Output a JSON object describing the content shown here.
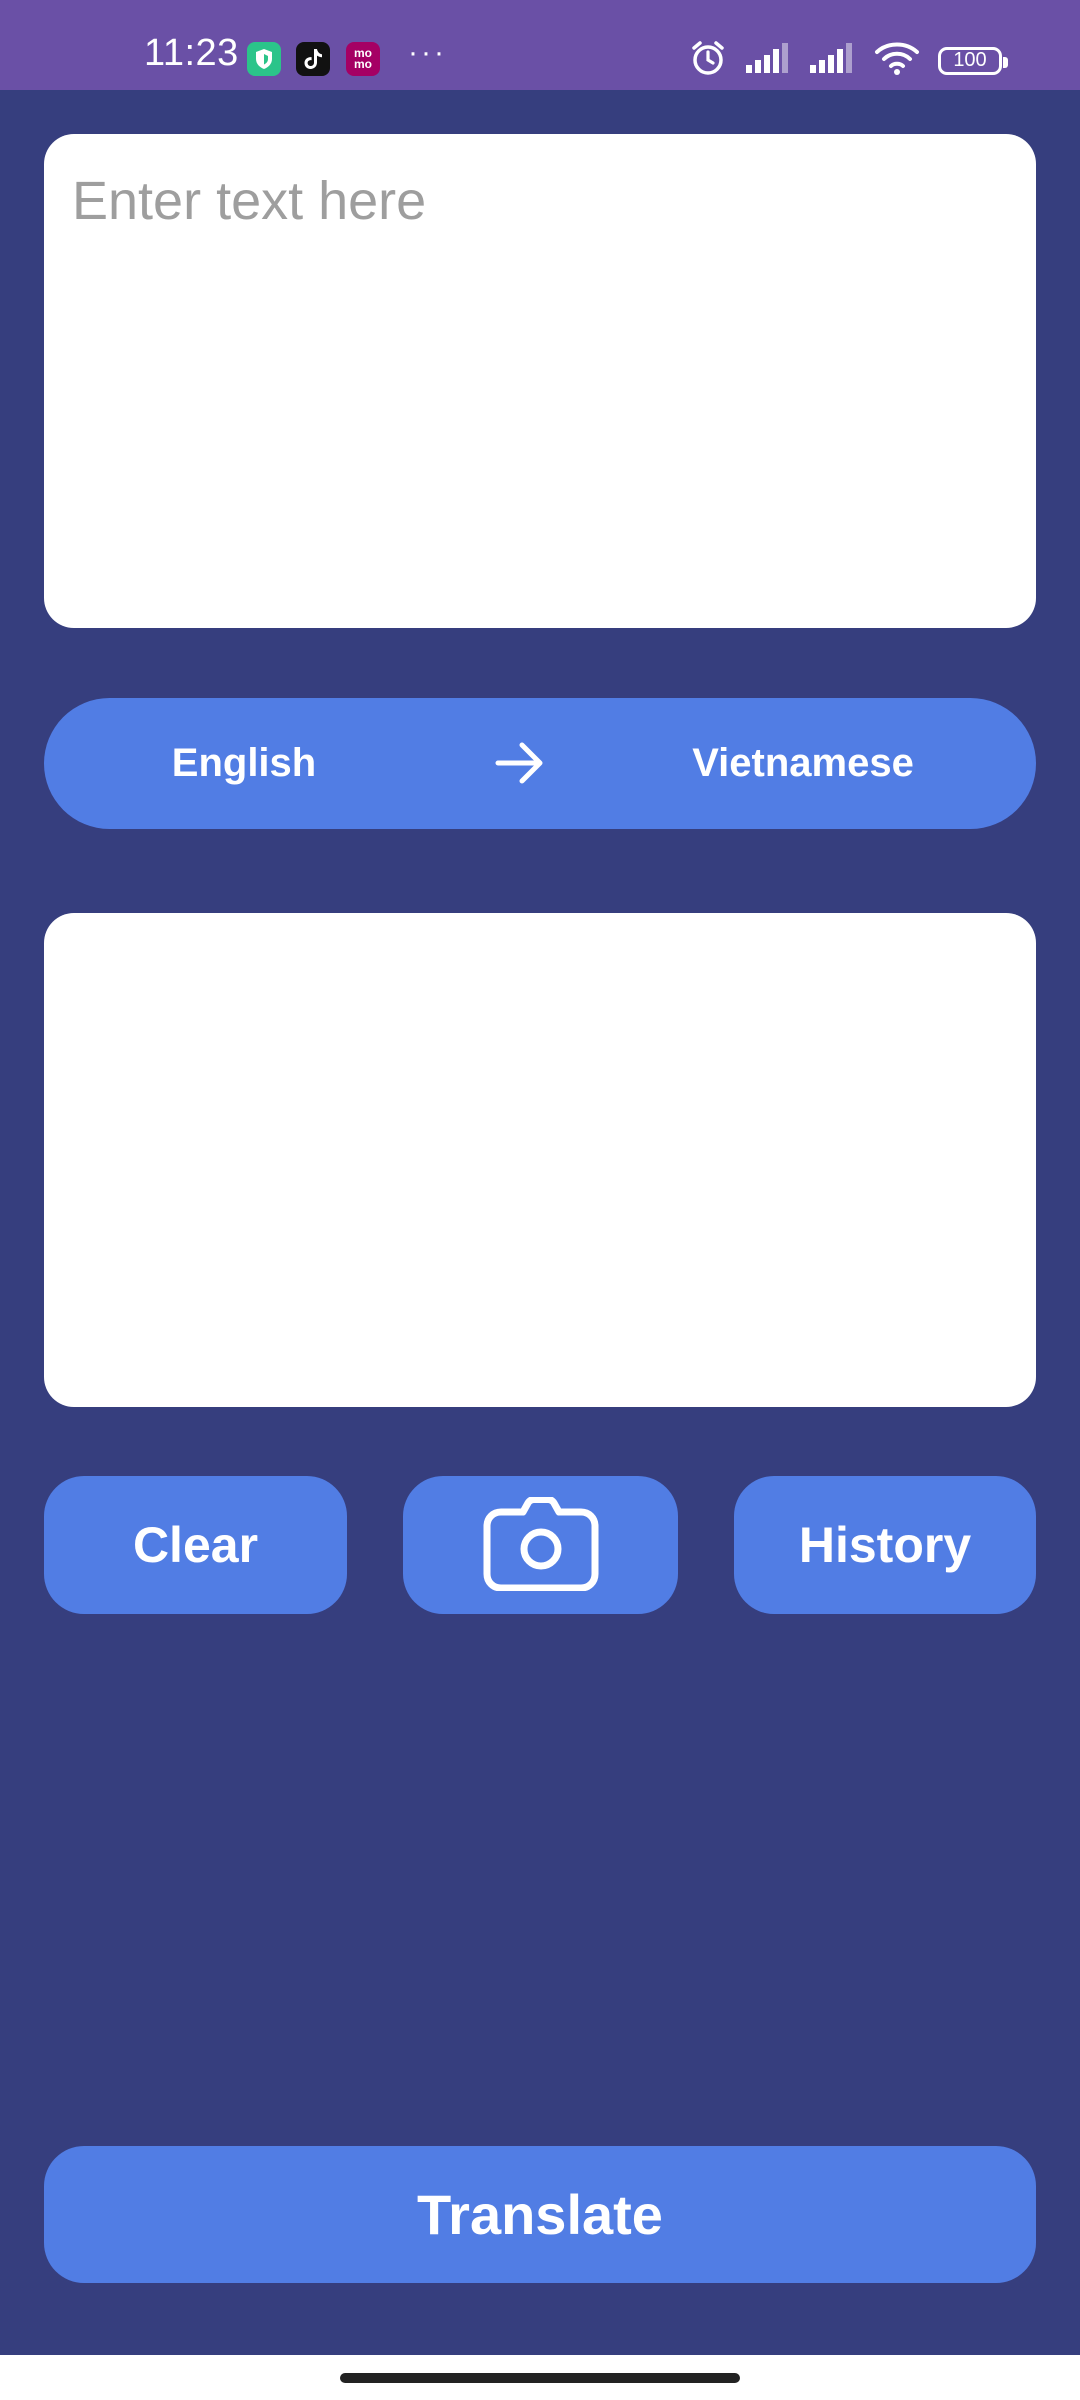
{
  "status_bar": {
    "time": "11:23",
    "app_icons": [
      "shield-icon",
      "tiktok-icon",
      "momo-icon"
    ],
    "momo_label": "mo mo",
    "overflow": "···",
    "battery_level": "100",
    "system_icons": [
      "alarm-icon",
      "signal-icon",
      "signal-icon",
      "wifi-icon",
      "battery-icon"
    ]
  },
  "input": {
    "placeholder": "Enter text here",
    "value": ""
  },
  "language_bar": {
    "source_language": "English",
    "target_language": "Vietnamese",
    "arrow_icon": "arrow-right-icon"
  },
  "output": {
    "value": ""
  },
  "actions": {
    "clear_label": "Clear",
    "camera_icon": "camera-icon",
    "history_label": "History"
  },
  "translate_label": "Translate",
  "colors": {
    "background": "#363E7E",
    "status_bar": "#6A50A6",
    "accent": "#517DE4",
    "card": "#FFFFFF",
    "placeholder": "#9E9E9E"
  }
}
